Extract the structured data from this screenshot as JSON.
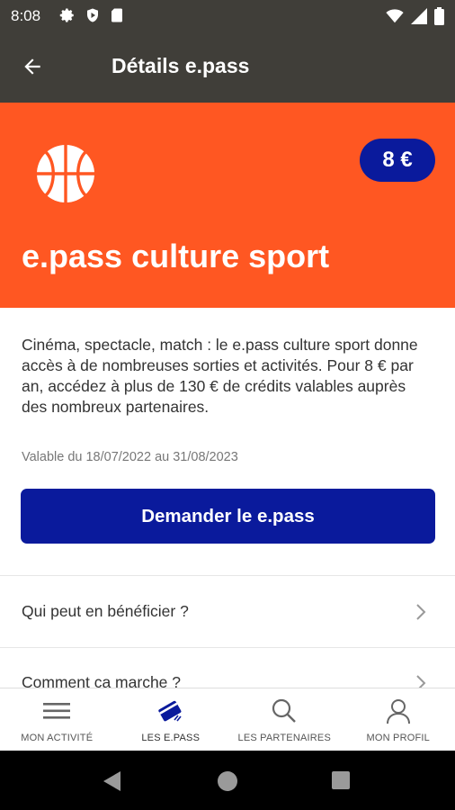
{
  "status_bar": {
    "time": "8:08",
    "icons_left": [
      "gear-icon",
      "play-protect-icon",
      "sd-card-icon"
    ],
    "icons_right": [
      "wifi-icon",
      "signal-icon",
      "battery-icon"
    ]
  },
  "app_bar": {
    "title": "Détails e.pass",
    "back_icon": "arrow-left-icon"
  },
  "hero": {
    "icon": "basketball-icon",
    "price": "8 €",
    "title": "e.pass culture sport",
    "background_color": "#ff5722"
  },
  "content": {
    "description": "Cinéma, spectacle, match : le e.pass culture sport donne accès à de nombreuses sorties et activités. Pour 8 € par an, accédez à plus de 130 € de crédits valables auprès des nombreux partenaires.",
    "validity": "Valable du 18/07/2022  au 31/08/2023",
    "cta_label": "Demander le e.pass",
    "accent_color": "#0a1a9c"
  },
  "accordion": [
    {
      "label": "Qui peut en bénéficier ?"
    },
    {
      "label": "Comment ça marche ?"
    }
  ],
  "bottom_nav": [
    {
      "label": "MON ACTIVITÉ",
      "icon": "menu-icon"
    },
    {
      "label": "LES E.PASS",
      "icon": "card-icon",
      "active": true
    },
    {
      "label": "LES PARTENAIRES",
      "icon": "search-icon"
    },
    {
      "label": "MON PROFIL",
      "icon": "user-icon"
    }
  ]
}
